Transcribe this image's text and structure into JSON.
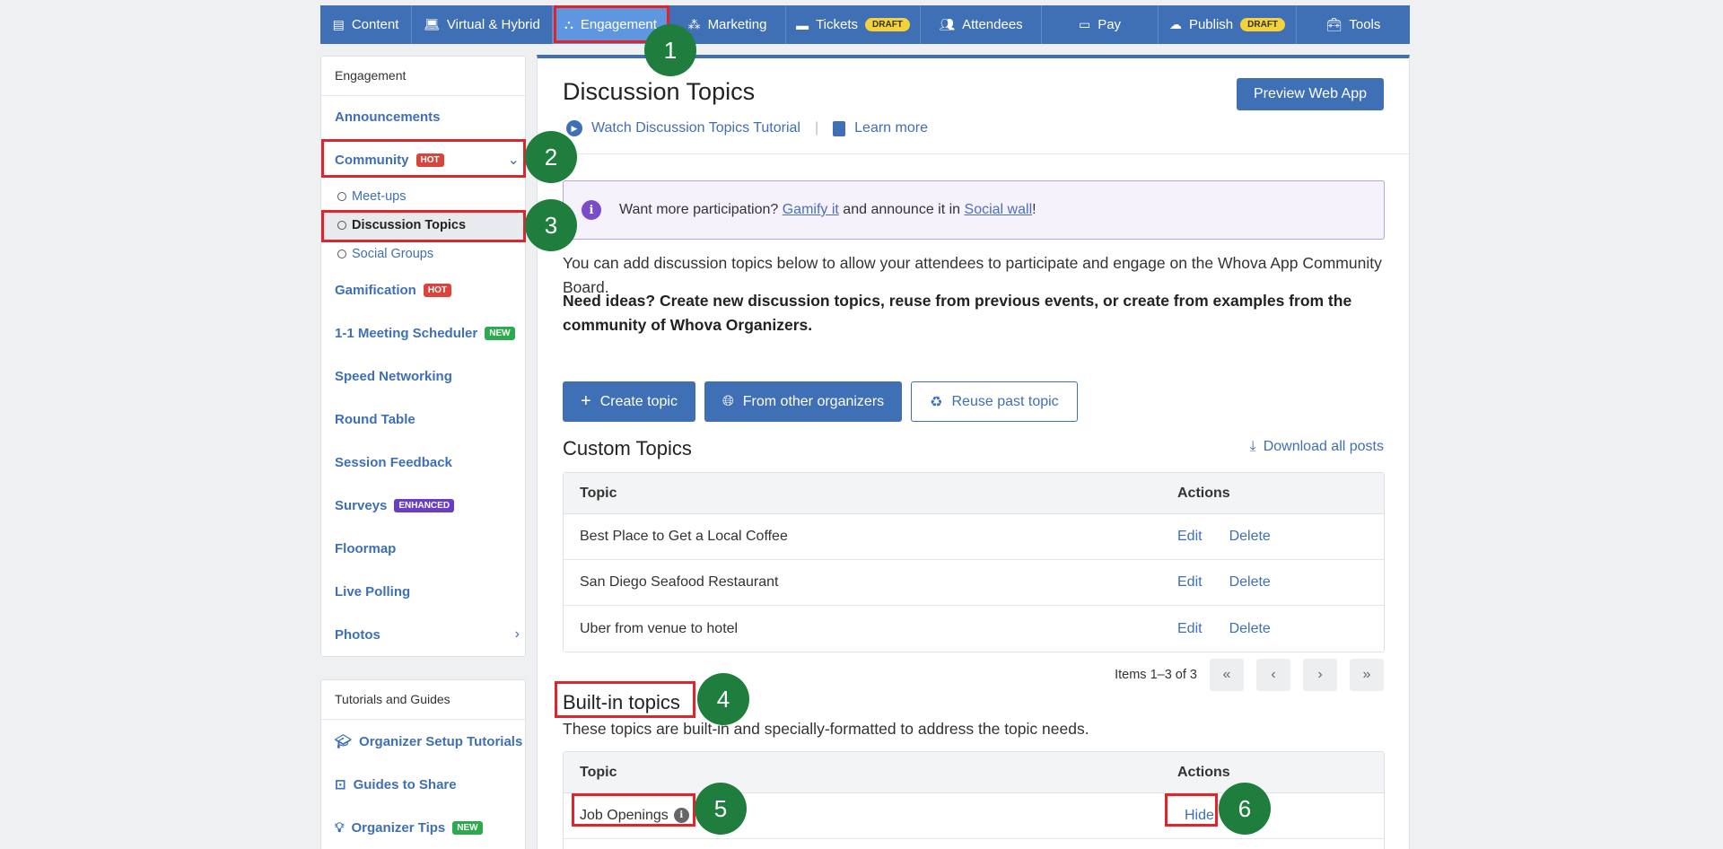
{
  "topnav": {
    "items": [
      {
        "label": "Content",
        "icon": "document-icon"
      },
      {
        "label": "Virtual & Hybrid",
        "icon": "laptop-icon"
      },
      {
        "label": "Engagement",
        "icon": "network-icon"
      },
      {
        "label": "Marketing",
        "icon": "shapes-icon"
      },
      {
        "label": "Tickets",
        "icon": "ticket-icon",
        "badge": "DRAFT"
      },
      {
        "label": "Attendees",
        "icon": "people-icon"
      },
      {
        "label": "Pay",
        "icon": "card-icon"
      },
      {
        "label": "Publish",
        "icon": "cloud-upload-icon",
        "badge": "DRAFT"
      },
      {
        "label": "Tools",
        "icon": "toolbox-icon"
      }
    ]
  },
  "sidebar": {
    "header": "Engagement",
    "announcements": "Announcements",
    "community": "Community",
    "community_badge": "HOT",
    "meetups": "Meet-ups",
    "discussion_topics": "Discussion Topics",
    "social_groups": "Social Groups",
    "gamification": "Gamification",
    "gamification_badge": "HOT",
    "meeting_scheduler": "1-1 Meeting Scheduler",
    "meeting_badge": "NEW",
    "speed_networking": "Speed Networking",
    "round_table": "Round Table",
    "session_feedback": "Session Feedback",
    "surveys": "Surveys",
    "surveys_badge": "ENHANCED",
    "floormap": "Floormap",
    "live_polling": "Live Polling",
    "photos": "Photos"
  },
  "sidebar2": {
    "header": "Tutorials and Guides",
    "setup_tutorials": "Organizer Setup Tutorials",
    "guides": "Guides to Share",
    "tips": "Organizer Tips",
    "tips_badge": "NEW"
  },
  "main": {
    "title": "Discussion Topics",
    "preview_button": "Preview Web App",
    "watch_link": "Watch Discussion Topics Tutorial",
    "learn_link": "Learn more",
    "info_text_1": "Want more participation?",
    "info_link_1": "Gamify it",
    "info_text_2": "and announce it in",
    "info_link_2": "Social wall",
    "info_text_3": "!",
    "description": "You can add discussion topics below to allow your attendees to participate and engage on the Whova App Community Board.",
    "ideas": "Need ideas? Create new discussion topics, reuse from previous events, or create from examples from the community of Whova Organizers.",
    "create_topic": "Create topic",
    "from_organizers": "From other organizers",
    "reuse_topic": "Reuse past topic",
    "custom_title": "Custom Topics",
    "download_all": "Download all posts",
    "col_topic": "Topic",
    "col_actions": "Actions",
    "edit": "Edit",
    "delete": "Delete",
    "custom_rows": [
      "Best Place to Get a Local Coffee",
      "San Diego Seafood Restaurant",
      "Uber from venue to hotel"
    ],
    "pager_text": "Items 1–3 of 3",
    "builtin_title": "Built-in topics",
    "builtin_desc": "These topics are built-in and specially-formatted to address the topic needs.",
    "builtin_rows": [
      "Job Openings"
    ],
    "hide": "Hide"
  },
  "steps": [
    "1",
    "2",
    "3",
    "4",
    "5",
    "6"
  ]
}
